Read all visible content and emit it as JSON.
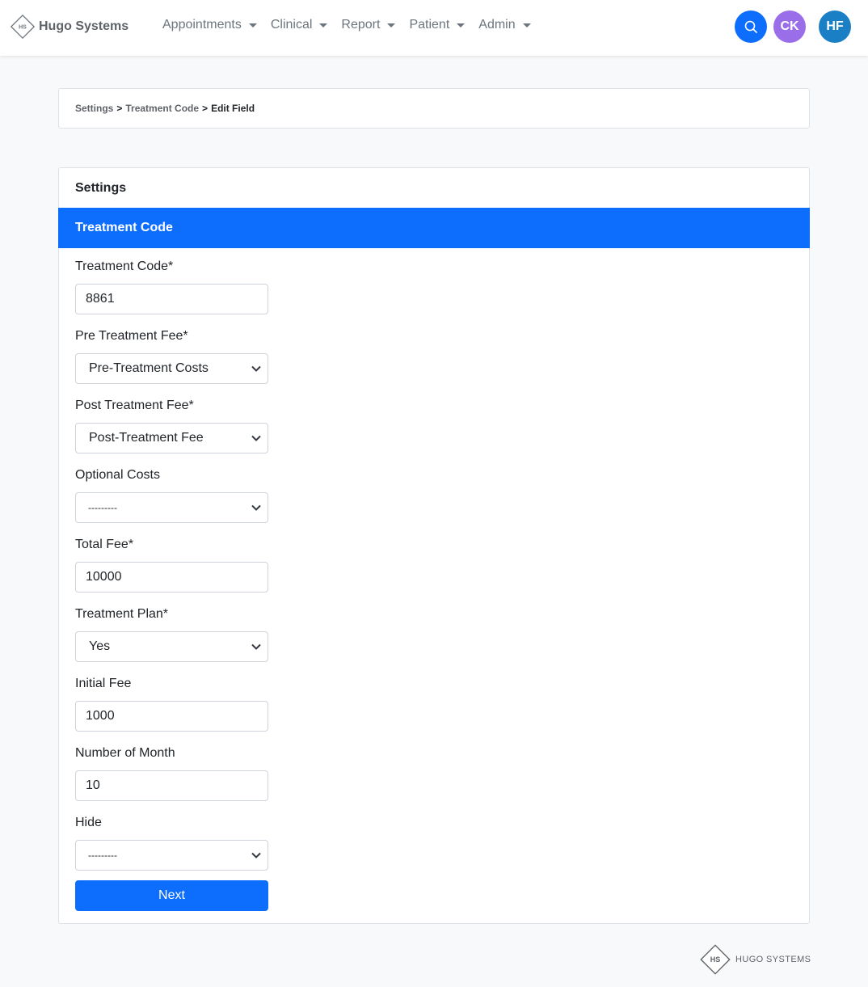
{
  "brand": {
    "name": "Hugo Systems",
    "logo_initials": "HS"
  },
  "nav": {
    "items": [
      {
        "label": "Appointments"
      },
      {
        "label": "Clinical"
      },
      {
        "label": "Report"
      },
      {
        "label": "Patient"
      },
      {
        "label": "Admin"
      }
    ]
  },
  "header_actions": {
    "search_icon": "search-icon",
    "avatar_1": "CK",
    "avatar_2": "HF"
  },
  "breadcrumb": {
    "items": [
      "Settings",
      "Treatment Code",
      "Edit Field"
    ],
    "separator": ">"
  },
  "card": {
    "title": "Settings",
    "section_title": "Treatment Code"
  },
  "form": {
    "treatment_code": {
      "label": "Treatment Code*",
      "value": "8861"
    },
    "pre_treatment_fee": {
      "label": "Pre Treatment Fee*",
      "selected": "Pre-Treatment Costs"
    },
    "post_treatment_fee": {
      "label": "Post Treatment Fee*",
      "selected": "Post-Treatment Fee"
    },
    "optional_costs": {
      "label": "Optional Costs",
      "selected": "---------"
    },
    "total_fee": {
      "label": "Total Fee*",
      "value": "10000"
    },
    "treatment_plan": {
      "label": "Treatment Plan*",
      "selected": "Yes"
    },
    "initial_fee": {
      "label": "Initial Fee",
      "value": "1000"
    },
    "number_of_month": {
      "label": "Number of Month",
      "value": "10"
    },
    "hide": {
      "label": "Hide",
      "selected": "---------"
    },
    "next_label": "Next"
  },
  "footer": {
    "logo_initials": "HS",
    "text": "HUGO SYSTEMS"
  },
  "colors": {
    "primary": "#0d6efd",
    "avatar_ck": "#9a6ee8",
    "avatar_hf": "#1b7fc6"
  }
}
